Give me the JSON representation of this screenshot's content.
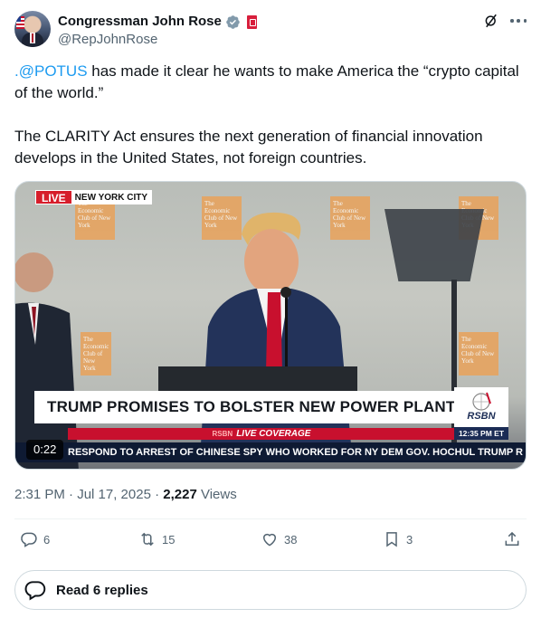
{
  "author": {
    "display_name": "Congressman John Rose",
    "handle": "@RepJohnRose",
    "verified_badge": "verified-checkmark-icon",
    "affiliate_badge": "government-badge-icon"
  },
  "header_actions": {
    "grok_icon": "grok-icon",
    "more_icon": "more-icon"
  },
  "tweet": {
    "mention": ".@POTUS",
    "line1_rest": " has made it clear he wants to make America the “crypto capital of the world.”",
    "paragraph2": "The CLARITY Act ensures the next generation of financial innovation develops in the United States, not foreign countries."
  },
  "video": {
    "live_label": "LIVE",
    "location": "NEW YORK CITY",
    "backdrop_sign": "The Economic Club of New York",
    "headline": "TRUMP PROMISES TO BOLSTER NEW POWER PLANTS",
    "coverage_prefix": "RSBN",
    "coverage_label": "LIVE COVERAGE",
    "network": "RSBN",
    "clock": "12:35 PM ET",
    "ticker": "RESPOND TO ARREST OF CHINESE SPY WHO WORKED FOR NY DEM GOV. HOCHUL     TRUMP R",
    "duration": "0:22",
    "colors": {
      "live_red": "#d61e2b",
      "ticker_navy": "#0e1a33",
      "coverage_red": "#c8102e"
    }
  },
  "meta": {
    "timestamp": "2:31 PM · Jul 17, 2025 · ",
    "views_count": "2,227",
    "views_label": " Views"
  },
  "engagement": {
    "replies": "6",
    "reposts": "15",
    "likes": "38",
    "bookmarks": "3"
  },
  "read_replies_label": "Read 6 replies",
  "accent_color": "#1d9bf0"
}
